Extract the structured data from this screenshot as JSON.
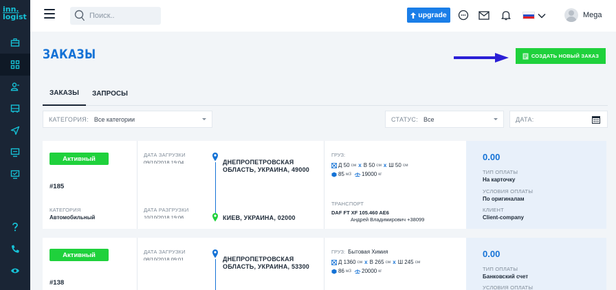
{
  "logo": {
    "line1": "inn.",
    "line2": "logist"
  },
  "sidebar": {
    "icons": [
      "briefcase-icon",
      "grid-icon",
      "users-icon",
      "truck-icon",
      "send-icon",
      "monitor-icon",
      "document-icon"
    ],
    "bottom_icons": [
      "help-icon",
      "phone-icon",
      "eye-icon"
    ]
  },
  "topbar": {
    "search_placeholder": "Поиск..",
    "upgrade_label": "upgrade",
    "username": "Mega"
  },
  "page": {
    "title": "ЗАКАЗЫ",
    "create_button": "СОЗДАТЬ НОВЫЙ ЗАКАЗ"
  },
  "tabs": [
    {
      "label": "ЗАКАЗЫ",
      "active": true
    },
    {
      "label": "ЗАПРОСЫ",
      "active": false
    }
  ],
  "filters": {
    "category_label": "КАТЕГОРИЯ:",
    "category_value": "Все категории",
    "status_label": "СТАТУС:",
    "status_value": "Все",
    "date_label": "ДАТА:"
  },
  "orders": [
    {
      "status": "Активный",
      "number": "#185",
      "category_label": "КАТЕГОРИЯ",
      "category": "Автомобильный",
      "load_date_label": "ДАТА ЗАГРУЗКИ",
      "load_date": "09/10/2018 19:04",
      "unload_date_label": "ДАТА РАЗГРУЗКИ",
      "unload_date": "10/10/2018 19:06",
      "from_line1": "ДНЕПРОПЕТРОВСКАЯ",
      "from_line2": "ОБЛАСТЬ, УКРАИНА, 49000",
      "to": "КИЕВ, УКРАИНА, 02000",
      "cargo_label": "ГРУЗ:",
      "cargo_name": "",
      "length": "Д 50",
      "length_unit": "см",
      "width": "В 50",
      "width_unit": "см",
      "height": "Ш 50",
      "height_unit": "см",
      "volume": "85",
      "volume_unit": "м3",
      "weight": "19000",
      "weight_unit": "кг",
      "transport_label": "ТРАНСПОРТ",
      "transport": "DAF FT XF 105.460 AE6",
      "driver": "Андрей Владимирович +38099",
      "price": "0.00",
      "payment_type_label": "ТИП ОПЛАТЫ",
      "payment_type": "На карточку",
      "payment_terms_label": "УСЛОВИЯ ОПЛАТЫ",
      "payment_terms": "По оригиналам",
      "client_label": "КЛИЕНТ",
      "client": "Client-company"
    },
    {
      "status": "Активный",
      "number": "#138",
      "load_date_label": "ДАТА ЗАГРУЗКИ",
      "load_date": "08/10/2018 09:01",
      "from_line1": "ДНЕПРОПЕТРОВСКАЯ",
      "from_line2": "ОБЛАСТЬ, УКРАИНА, 53300",
      "cargo_label": "ГРУЗ:",
      "cargo_name": "Бытовая Химия",
      "length": "Д 1360",
      "length_unit": "см",
      "width": "В 265",
      "width_unit": "см",
      "height": "Ш 245",
      "height_unit": "см",
      "volume": "86",
      "volume_unit": "м3",
      "weight": "20000",
      "weight_unit": "кг",
      "price": "0.00",
      "payment_type_label": "ТИП ОПЛАТЫ",
      "payment_type": "Банковский счет",
      "payment_terms_label": "УСЛОВИЯ ОПЛАТЫ"
    }
  ],
  "colors": {
    "sidebar": "#1a2535",
    "accent_blue": "#1472d6",
    "upgrade": "#1a7ee8",
    "green": "#1fd13c",
    "logo": "#16c1d6",
    "arrow": "#2b1fd6"
  }
}
